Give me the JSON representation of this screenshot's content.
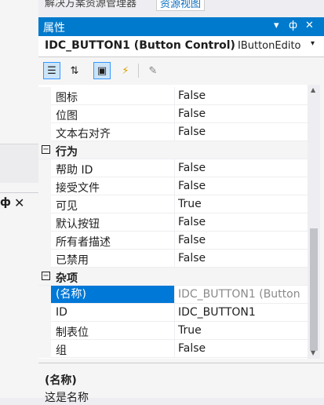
{
  "top_tabs": {
    "solution_explorer": "解决方案资源管理器",
    "resource_view": "资源视图"
  },
  "left_pane": {
    "pin_glyph": "ф",
    "close_glyph": "✕"
  },
  "panel": {
    "title": "属性",
    "title_icons": [
      "dropdown-icon",
      "pin-icon",
      "close-icon"
    ],
    "object": {
      "name": "IDC_BUTTON1 (Button Control)",
      "type": "IButtonEdito"
    },
    "toolbar": [
      "categorized-icon",
      "alphabetical-icon",
      "properties-icon",
      "events-icon",
      "property-pages-icon"
    ],
    "rows": [
      {
        "kind": "prop",
        "name": "图标",
        "value": "False"
      },
      {
        "kind": "prop",
        "name": "位图",
        "value": "False"
      },
      {
        "kind": "prop",
        "name": "文本右对齐",
        "value": "False"
      },
      {
        "kind": "cat",
        "name": "行为",
        "toggle": "−"
      },
      {
        "kind": "prop",
        "name": "帮助 ID",
        "value": "False"
      },
      {
        "kind": "prop",
        "name": "接受文件",
        "value": "False"
      },
      {
        "kind": "prop",
        "name": "可见",
        "value": "True"
      },
      {
        "kind": "prop",
        "name": "默认按钮",
        "value": "False"
      },
      {
        "kind": "prop",
        "name": "所有者描述",
        "value": "False"
      },
      {
        "kind": "prop",
        "name": "已禁用",
        "value": "False"
      },
      {
        "kind": "cat",
        "name": "杂项",
        "toggle": "−"
      },
      {
        "kind": "prop",
        "name": "(名称)",
        "value": "IDC_BUTTON1 (Button",
        "selected": true,
        "grey": true
      },
      {
        "kind": "prop",
        "name": "ID",
        "value": "IDC_BUTTON1"
      },
      {
        "kind": "prop",
        "name": "制表位",
        "value": "True"
      },
      {
        "kind": "prop",
        "name": "组",
        "value": "False"
      }
    ],
    "description": {
      "title": "(名称)",
      "text": "这是名称"
    }
  }
}
